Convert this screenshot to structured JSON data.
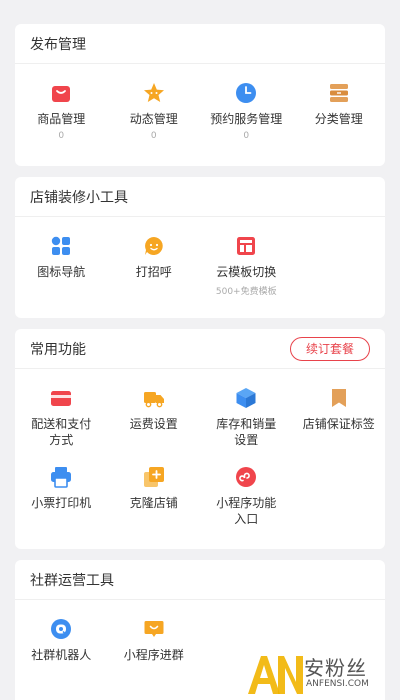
{
  "colors": {
    "accent": "#e8434b",
    "background": "#f1f1f3",
    "card": "#ffffff"
  },
  "sections": [
    {
      "title": "发布管理",
      "items": [
        {
          "label": "商品管理",
          "sub": "0",
          "icon": "shopping-bag-icon"
        },
        {
          "label": "动态管理",
          "sub": "0",
          "icon": "star-badge-icon"
        },
        {
          "label": "预约服务管理",
          "sub": "0",
          "icon": "clock-icon"
        },
        {
          "label": "分类管理",
          "sub": "",
          "icon": "cabinet-icon"
        }
      ]
    },
    {
      "title": "店铺装修小工具",
      "items": [
        {
          "label": "图标导航",
          "sub": "",
          "icon": "grid-nav-icon"
        },
        {
          "label": "打招呼",
          "sub": "",
          "icon": "smile-chat-icon"
        },
        {
          "label": "云模板切换",
          "sub": "500+免费模板",
          "icon": "template-icon"
        }
      ]
    },
    {
      "title": "常用功能",
      "button": "续订套餐",
      "items": [
        {
          "label": "配送和支付\n方式",
          "icon": "card-icon"
        },
        {
          "label": "运费设置",
          "icon": "truck-icon"
        },
        {
          "label": "库存和销量\n设置",
          "icon": "box-icon"
        },
        {
          "label": "店铺保证标签",
          "icon": "bookmark-icon"
        },
        {
          "label": "小票打印机",
          "icon": "printer-icon"
        },
        {
          "label": "克隆店铺",
          "icon": "clone-icon"
        },
        {
          "label": "小程序功能\n入口",
          "icon": "mini-program-icon"
        }
      ]
    },
    {
      "title": "社群运营工具",
      "items": [
        {
          "label": "社群机器人",
          "icon": "robot-chat-icon"
        },
        {
          "label": "小程序进群",
          "icon": "group-chat-icon"
        }
      ]
    }
  ],
  "watermark": {
    "logo": "AN",
    "text_cn": "安粉丝",
    "text_en": "ANFENSI.COM"
  }
}
